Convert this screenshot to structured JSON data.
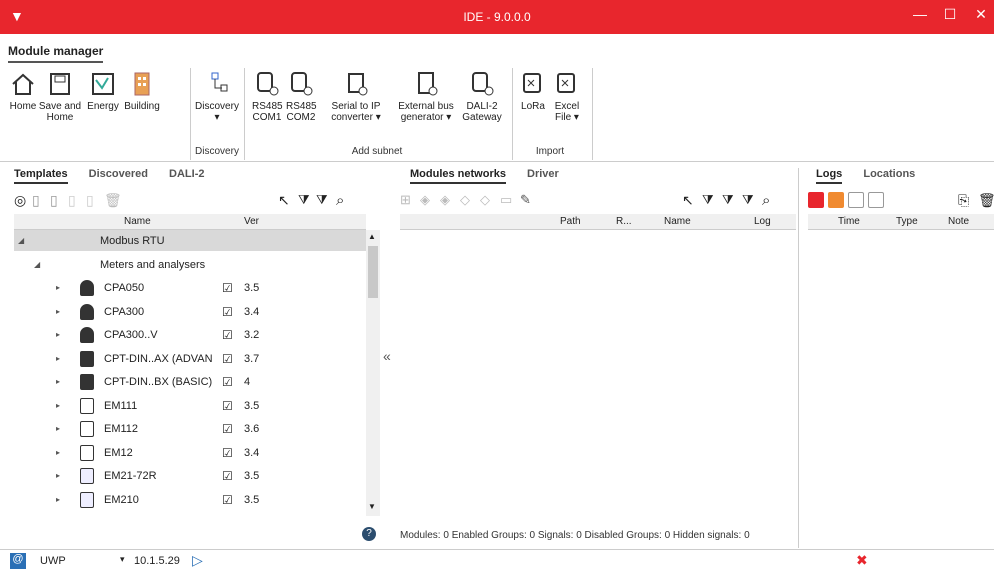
{
  "window": {
    "title": "IDE - 9.0.0.0",
    "minimize": "—",
    "maximize": "☐",
    "close": "✕"
  },
  "ribbon": {
    "tab": "Module manager",
    "buttons": [
      {
        "label": "Home"
      },
      {
        "label": "Save and Home"
      },
      {
        "label": "Energy"
      },
      {
        "label": "Building"
      },
      {
        "label": "Discovery"
      },
      {
        "label": "RS485 COM1"
      },
      {
        "label": "RS485 COM2"
      },
      {
        "label": "Serial to IP converter ▾"
      },
      {
        "label": "External bus generator ▾"
      },
      {
        "label": "DALI-2 Gateway"
      },
      {
        "label": "LoRa"
      },
      {
        "label": "Excel File ▾"
      }
    ],
    "groups": {
      "discovery": "Discovery",
      "add_subnet": "Add subnet",
      "import": "Import"
    }
  },
  "left": {
    "tabs": [
      "Templates",
      "Discovered",
      "DALI-2"
    ],
    "columns": {
      "name": "Name",
      "ver": "Ver"
    },
    "rows": [
      {
        "name": "Modbus RTU",
        "ver": ""
      },
      {
        "name": "Meters and analysers",
        "ver": ""
      },
      {
        "name": "CPA050",
        "ver": "3.5"
      },
      {
        "name": "CPA300",
        "ver": "3.4"
      },
      {
        "name": "CPA300..V",
        "ver": "3.2"
      },
      {
        "name": "CPT-DIN..AX (ADVAN",
        "ver": "3.7"
      },
      {
        "name": "CPT-DIN..BX (BASIC)",
        "ver": "4"
      },
      {
        "name": "EM111",
        "ver": "3.5"
      },
      {
        "name": "EM112",
        "ver": "3.6"
      },
      {
        "name": "EM12",
        "ver": "3.4"
      },
      {
        "name": "EM21-72R",
        "ver": "3.5"
      },
      {
        "name": "EM210",
        "ver": "3.5"
      }
    ]
  },
  "middle": {
    "tabs": [
      "Modules networks",
      "Driver"
    ],
    "columns": {
      "path": "Path",
      "r": "R...",
      "name": "Name",
      "log": "Log"
    },
    "footer": "Modules: 0 Enabled Groups: 0 Signals: 0 Disabled Groups: 0 Hidden signals: 0"
  },
  "right": {
    "tabs": [
      "Logs",
      "Locations"
    ],
    "columns": {
      "time": "Time",
      "type": "Type",
      "note": "Note"
    }
  },
  "collapse_glyph": "«",
  "status": {
    "connection": "UWP",
    "ip": "10.1.5.29"
  },
  "colors": {
    "titlebar": "#e8262d",
    "accent": "#e8262d"
  }
}
